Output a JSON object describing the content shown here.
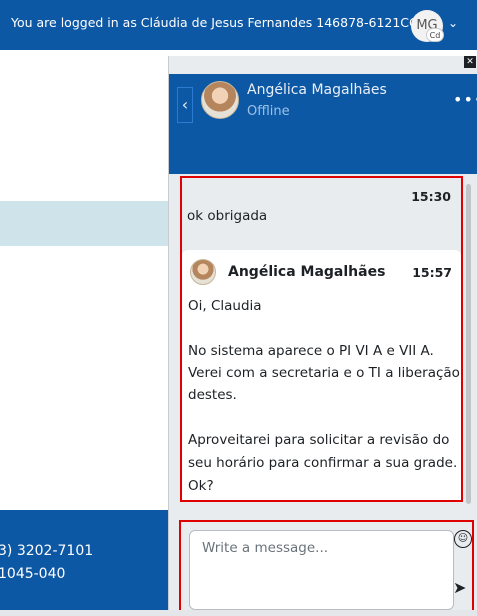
{
  "navbar": {
    "login_text": "You are logged in as Cláudia de Jesus Fernandes 146878-6121CCO",
    "avatar_initials": "MG",
    "avatar_badge": "Cd"
  },
  "footer": {
    "phone": "3) 3202-7101",
    "postal": "1045-040"
  },
  "drawer": {
    "contact": {
      "name": "Angélica Magalhães",
      "status": "Offline"
    },
    "messages": {
      "sent": {
        "time": "15:30",
        "text": "ok obrigada"
      },
      "received": {
        "sender": "Angélica Magalhães",
        "time": "15:57",
        "lines": [
          "Oi, Claudia",
          "",
          "No sistema aparece o PI VI A e VII A.",
          "Verei com a secretaria e o TI a liberação",
          "destes.",
          "",
          "Aproveitarei para solicitar a revisão do",
          "seu horário para confirmar a sua grade.",
          "Ok?"
        ]
      }
    },
    "composer": {
      "placeholder": "Write a message..."
    }
  },
  "colors": {
    "brand": "#0d58a4",
    "highlight_border": "#e00000"
  }
}
